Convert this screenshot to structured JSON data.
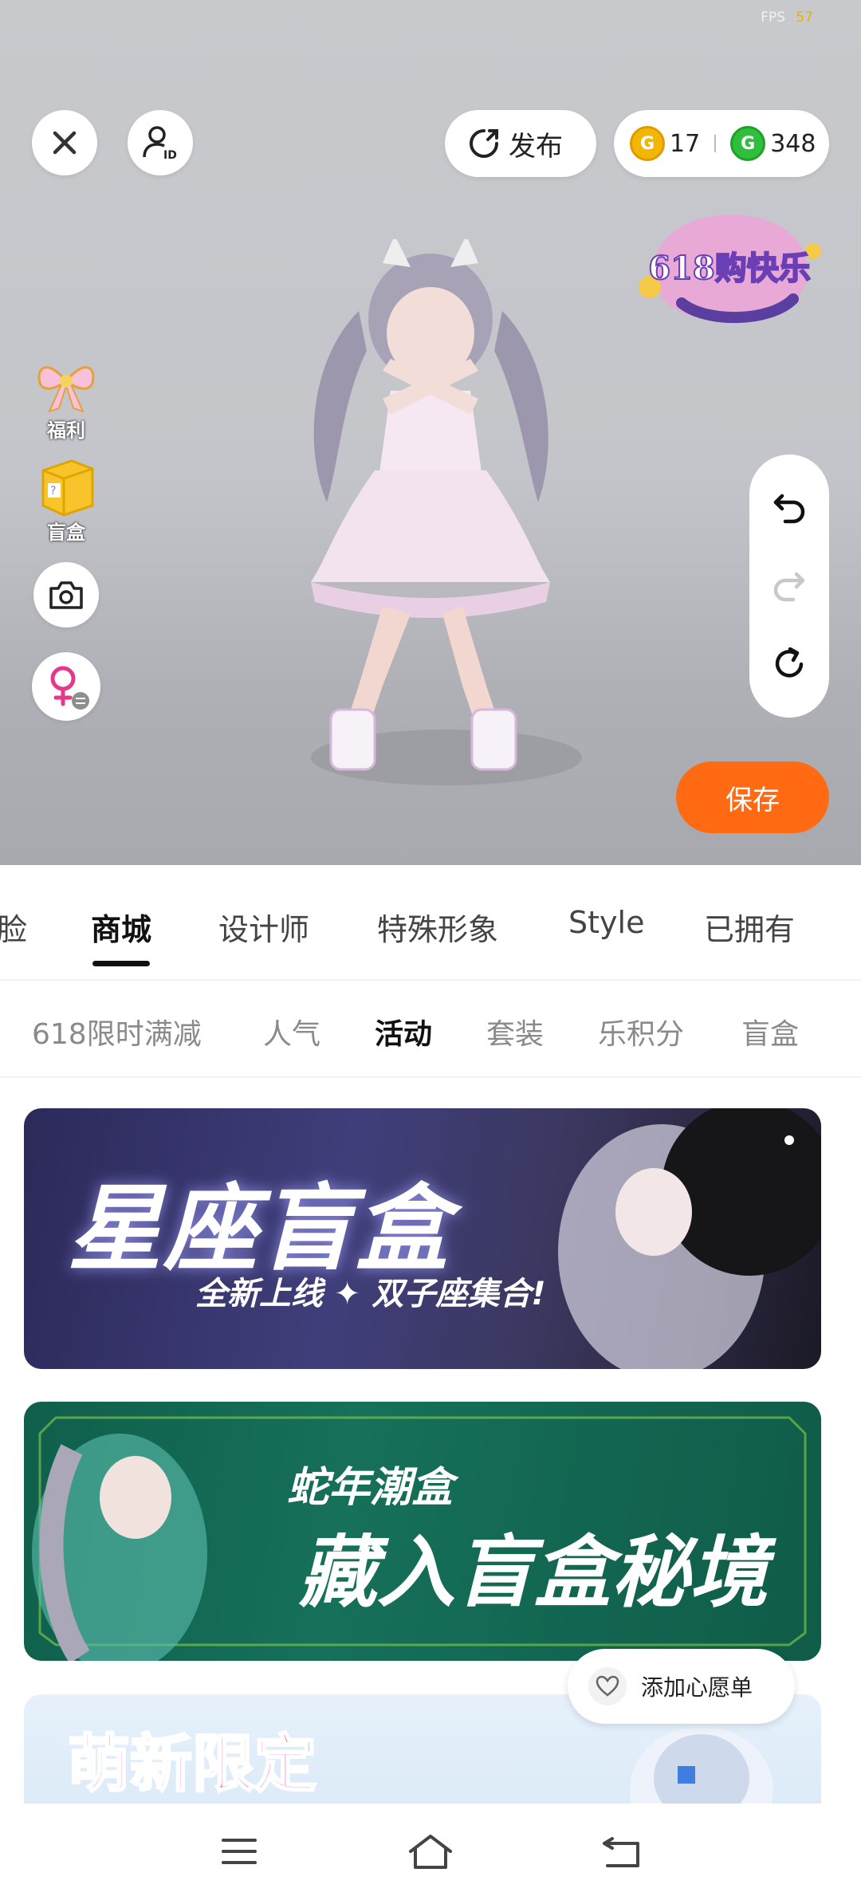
{
  "status": {
    "fps_label": "FPS",
    "fps_value": "57"
  },
  "top": {
    "publish_label": "发布",
    "coins_gold": "17",
    "coins_green": "348",
    "promo_badge_text": "618购快乐"
  },
  "side": {
    "welfare_label": "福利",
    "blindbox_label": "盲盒"
  },
  "save_label": "保存",
  "main_tabs": [
    {
      "label": "脸"
    },
    {
      "label": "商城"
    },
    {
      "label": "设计师"
    },
    {
      "label": "特殊形象"
    },
    {
      "label": "Style"
    },
    {
      "label": "已拥有"
    }
  ],
  "active_main_tab": "商城",
  "sub_tabs": [
    {
      "label": "618限时满减"
    },
    {
      "label": "人气"
    },
    {
      "label": "活动"
    },
    {
      "label": "套装"
    },
    {
      "label": "乐积分"
    },
    {
      "label": "盲盒"
    }
  ],
  "active_sub_tab": "活动",
  "banners": [
    {
      "title": "星座盲盒",
      "subtitle": "全新上线 ✦ 双子座集合!"
    },
    {
      "title_line1": "蛇年潮盒",
      "title_line2": "藏入盲盒秘境"
    },
    {
      "title": "萌新限定"
    }
  ],
  "wishlist_label": "添加心愿单",
  "colors": {
    "accent": "#ff6a13",
    "gold": "#f2b705",
    "green": "#2fbf3c"
  }
}
